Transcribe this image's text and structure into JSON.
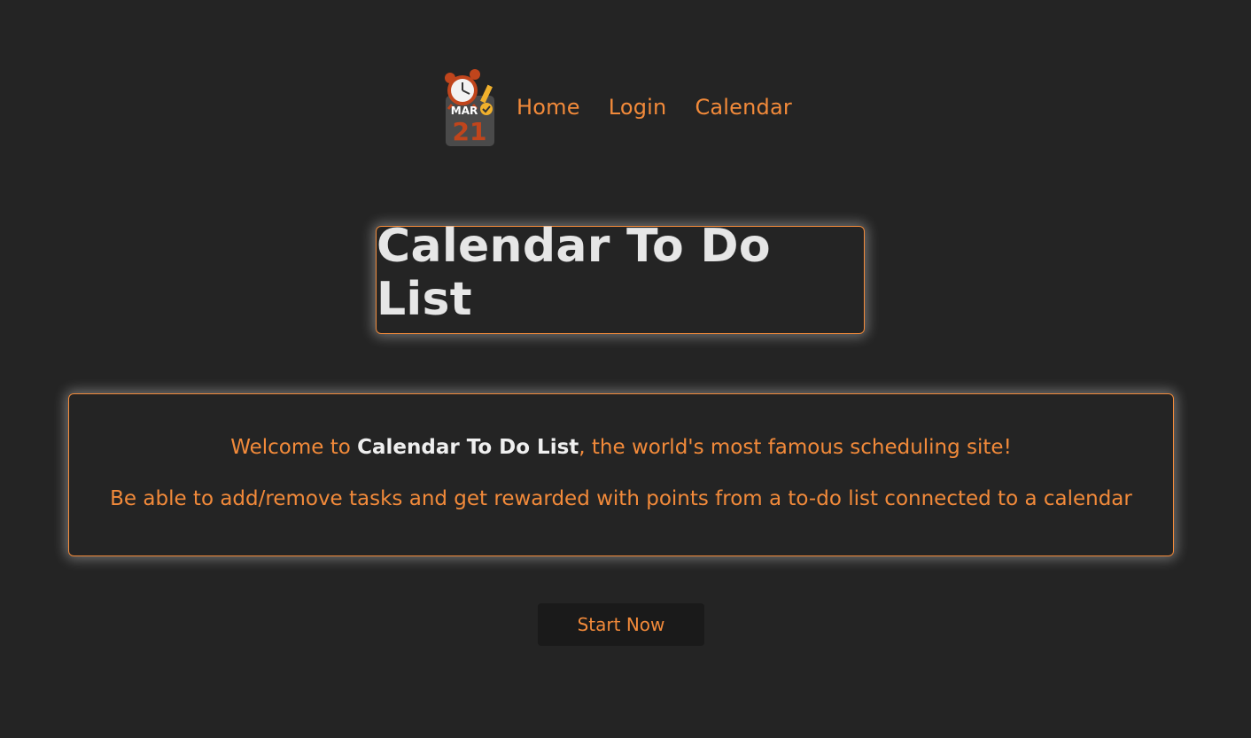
{
  "nav": {
    "logo": {
      "month": "MAR",
      "day": "21",
      "icon": "calendar-alarm-clock-icon"
    },
    "links": [
      {
        "label": "Home"
      },
      {
        "label": "Login"
      },
      {
        "label": "Calendar"
      }
    ]
  },
  "hero": {
    "title": "Calendar To Do List"
  },
  "welcome": {
    "line1_prefix": "Welcome to ",
    "line1_brand": "Calendar To Do List",
    "line1_suffix": ", the world's most famous scheduling site!",
    "line2": "Be able to add/remove tasks and get rewarded with points from a to-do list connected to a calendar"
  },
  "cta": {
    "label": "Start Now"
  },
  "colors": {
    "background": "#242424",
    "accent": "#f28a3a",
    "title_text": "#e6e6e6",
    "button_bg": "#1a1a1a"
  }
}
